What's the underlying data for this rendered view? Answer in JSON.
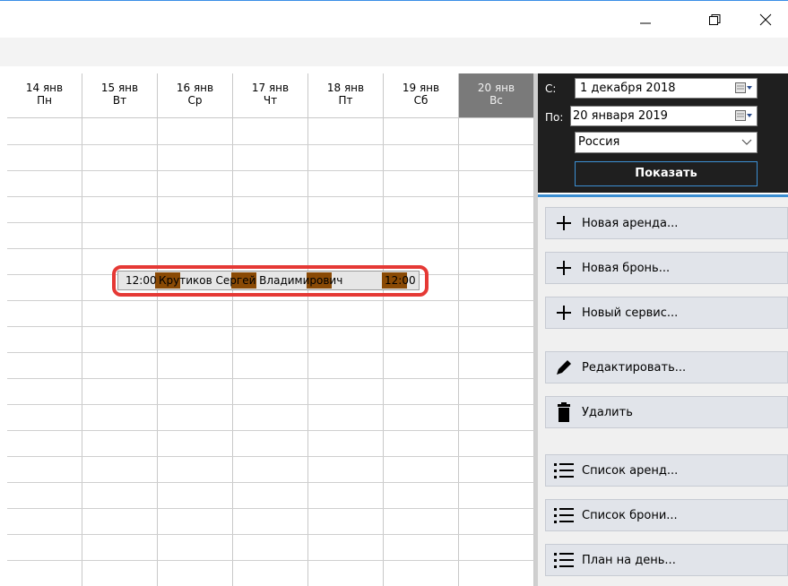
{
  "window": {
    "controls": [
      "minimize-icon",
      "maximize-icon",
      "close-icon"
    ]
  },
  "calendar": {
    "days": [
      {
        "date": "14 янв",
        "weekday": "Пн",
        "today": false
      },
      {
        "date": "15 янв",
        "weekday": "Вт",
        "today": false
      },
      {
        "date": "16 янв",
        "weekday": "Ср",
        "today": false
      },
      {
        "date": "17 янв",
        "weekday": "Чт",
        "today": false
      },
      {
        "date": "18 янв",
        "weekday": "Пт",
        "today": false
      },
      {
        "date": "19 янв",
        "weekday": "Сб",
        "today": false
      },
      {
        "date": "20 янв",
        "weekday": "Вс",
        "today": true
      }
    ],
    "today_color": "#7a7a7a",
    "booking": {
      "start_time": "12:00",
      "guest": "Крутиков Сергей Владимирович",
      "end_time": "12:00",
      "bar_color": "#8a4a05",
      "highlight_color": "#e53935"
    }
  },
  "filter": {
    "from_label": "С:",
    "from_value": "1 декабря 2018",
    "to_label": "По:",
    "to_value": "20 января 2019",
    "country": "Россия",
    "show_label": "Показать",
    "accent": "#3c8fd3"
  },
  "actions": {
    "new_rental": "Новая аренда...",
    "new_booking": "Новая бронь...",
    "new_service": "Новый сервис...",
    "edit": "Редактировать...",
    "delete": "Удалить",
    "rental_list": "Список аренд...",
    "booking_list": "Список брони...",
    "day_plan": "План на день..."
  }
}
